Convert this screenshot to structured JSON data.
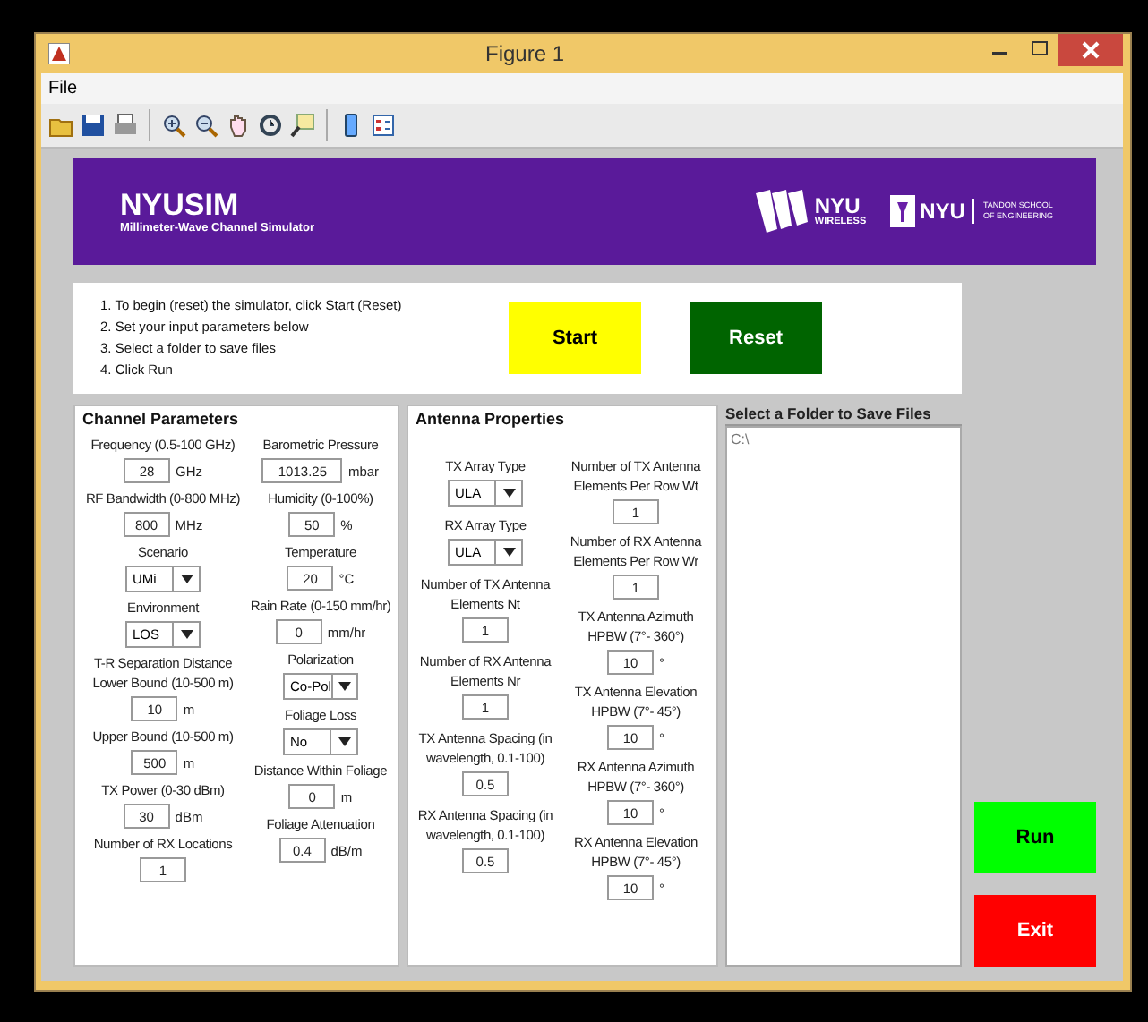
{
  "window": {
    "title": "Figure 1"
  },
  "menu": [
    "File"
  ],
  "banner": {
    "title": "NYUSIM",
    "subtitle": "Millimeter-Wave Channel Simulator",
    "logo_1": {
      "line_1": "NYU",
      "line_2": "WIRELESS"
    },
    "logo_2": {
      "name": "NYU",
      "line_1": "TANDON SCHOOL",
      "line_2": "OF ENGINEERING"
    }
  },
  "instructions": [
    "1. To begin (reset) the simulator, click Start (Reset)",
    "2. Set your input parameters below",
    "3. Select a folder to save files",
    "4. Click Run"
  ],
  "top_buttons": [
    {
      "label": "Start",
      "color": "#ffff00"
    },
    {
      "label": "Reset",
      "color": "#006400"
    }
  ],
  "channel_parameters": {
    "title": "Channel Parameters",
    "left": [
      {
        "kind": "field",
        "label": "Frequency (0.5-100 GHz)",
        "value": "28",
        "unit": "GHz"
      },
      {
        "kind": "field",
        "label": "RF Bandwidth (0-800 MHz)",
        "value": "800",
        "unit": "MHz"
      },
      {
        "kind": "dropdown",
        "label": "Scenario",
        "value": "UMi"
      },
      {
        "kind": "dropdown",
        "label": "Environment",
        "value": "LOS"
      },
      {
        "kind": "heading",
        "label": "T-R Separation Distance"
      },
      {
        "kind": "field",
        "label": "Lower Bound (10-500 m)",
        "value": "10",
        "unit": "m"
      },
      {
        "kind": "field",
        "label": "Upper Bound (10-500 m)",
        "value": "500",
        "unit": "m"
      },
      {
        "kind": "field",
        "label": "TX Power (0-30 dBm)",
        "value": "30",
        "unit": "dBm"
      },
      {
        "kind": "field",
        "label": "Number of RX Locations",
        "value": "1"
      }
    ],
    "right": [
      {
        "kind": "field",
        "label": "Barometric Pressure",
        "value": "1013.25",
        "unit": "mbar"
      },
      {
        "kind": "field",
        "label": "Humidity (0-100%)",
        "value": "50",
        "unit": "%"
      },
      {
        "kind": "field",
        "label": "Temperature",
        "value": "20",
        "unit": "°C"
      },
      {
        "kind": "field",
        "label": "Rain Rate (0-150 mm/hr)",
        "value": "0",
        "unit": "mm/hr"
      },
      {
        "kind": "dropdown",
        "label": "Polarization",
        "value": "Co-Pol"
      },
      {
        "kind": "dropdown",
        "label": "Foliage Loss",
        "value": "No"
      },
      {
        "kind": "field",
        "label": "Distance Within Foliage",
        "value": "0",
        "unit": "m"
      },
      {
        "kind": "field",
        "label": "Foliage Attenuation",
        "value": "0.4",
        "unit": "dB/m"
      }
    ]
  },
  "antenna_properties": {
    "title": "Antenna Properties",
    "left": [
      {
        "kind": "dropdown",
        "label": "TX Array Type",
        "value": "ULA"
      },
      {
        "kind": "dropdown",
        "label": "RX Array Type",
        "value": "ULA"
      },
      {
        "kind": "field",
        "label": "Number of TX Antenna Elements Nt",
        "value": "1"
      },
      {
        "kind": "field",
        "label": "Number of RX Antenna Elements Nr",
        "value": "1"
      },
      {
        "kind": "field",
        "label": "TX Antenna Spacing (in wavelength, 0.1-100)",
        "value": "0.5"
      },
      {
        "kind": "field",
        "label": "RX Antenna Spacing (in wavelength, 0.1-100)",
        "value": "0.5"
      }
    ],
    "right": [
      {
        "kind": "field",
        "label": "Number of TX Antenna Elements Per Row Wt",
        "value": "1"
      },
      {
        "kind": "field",
        "label": "Number of RX Antenna Elements Per Row Wr",
        "value": "1"
      },
      {
        "kind": "field",
        "label": "TX Antenna Azimuth HPBW (7°- 360°)",
        "value": "10",
        "unit": "°"
      },
      {
        "kind": "field",
        "label": "TX Antenna Elevation HPBW (7°- 45°)",
        "value": "10",
        "unit": "°"
      },
      {
        "kind": "field",
        "label": "RX Antenna Azimuth HPBW (7°- 360°)",
        "value": "10",
        "unit": "°"
      },
      {
        "kind": "field",
        "label": "RX Antenna Elevation HPBW (7°- 45°)",
        "value": "10",
        "unit": "°"
      }
    ]
  },
  "folder": {
    "title": "Select a Folder to Save Files",
    "items": [
      "C:\\"
    ]
  },
  "side_buttons": [
    {
      "label": "Run",
      "color": "#00ff00"
    },
    {
      "label": "Exit",
      "color": "#ff0000"
    }
  ]
}
